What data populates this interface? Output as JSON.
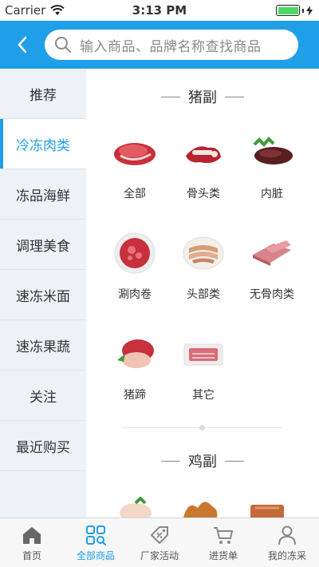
{
  "status_bar": {
    "carrier": "Carrier",
    "time": "3:13 PM"
  },
  "header": {
    "search_placeholder": "输入商品、品牌名称查找商品"
  },
  "sidebar": {
    "items": [
      {
        "label": "推荐"
      },
      {
        "label": "冷冻肉类",
        "active": true
      },
      {
        "label": "冻品海鲜"
      },
      {
        "label": "调理美食"
      },
      {
        "label": "速冻米面"
      },
      {
        "label": "速冻果蔬"
      },
      {
        "label": "关注"
      },
      {
        "label": "最近购买"
      }
    ]
  },
  "sections": [
    {
      "title": "猪副",
      "items": [
        {
          "label": "全部",
          "icon": "pork-chunk-icon"
        },
        {
          "label": "骨头类",
          "icon": "pork-bone-icon"
        },
        {
          "label": "内脏",
          "icon": "offal-icon"
        },
        {
          "label": "涮肉卷",
          "icon": "meat-roll-plate-icon"
        },
        {
          "label": "头部类",
          "icon": "pig-head-slices-icon"
        },
        {
          "label": "无骨肉类",
          "icon": "boneless-meat-icon"
        },
        {
          "label": "猪蹄",
          "icon": "pork-trotter-icon"
        },
        {
          "label": "其它",
          "icon": "pork-pack-icon"
        }
      ]
    },
    {
      "title": "鸡副",
      "items": []
    }
  ],
  "tabbar": {
    "items": [
      {
        "label": "首页",
        "icon": "home-icon"
      },
      {
        "label": "全部商品",
        "icon": "grid-search-icon",
        "active": true
      },
      {
        "label": "厂家活动",
        "icon": "discount-tag-icon"
      },
      {
        "label": "进货单",
        "icon": "cart-icon"
      },
      {
        "label": "我的冻采",
        "icon": "user-icon"
      }
    ]
  },
  "colors": {
    "brand": "#1f9fe8",
    "sidebar_bg": "#eef2f6"
  }
}
